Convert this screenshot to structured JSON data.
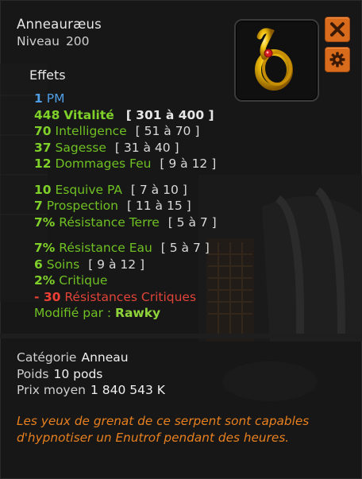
{
  "item": {
    "name": "Anneauræus",
    "level_label": "Niveau",
    "level": "200"
  },
  "buttons": {
    "close_icon": "close-icon",
    "gear_icon": "gear-icon"
  },
  "effects_title": "Effets",
  "effects": {
    "pm": {
      "value": "1",
      "name": "PM"
    },
    "vitalite": {
      "value": "448",
      "name": "Vitalité",
      "range": "[ 301 à 400 ]"
    },
    "intelligence": {
      "value": "70",
      "name": "Intelligence",
      "range": "[ 51 à 70 ]"
    },
    "sagesse": {
      "value": "37",
      "name": "Sagesse",
      "range": "[ 31 à 40 ]"
    },
    "dommages_feu": {
      "value": "12",
      "name": "Dommages Feu",
      "range": "[ 9 à 12 ]"
    },
    "esquive_pa": {
      "value": "10",
      "name": "Esquive PA",
      "range": "[ 7 à 10 ]"
    },
    "prospection": {
      "value": "7",
      "name": "Prospection",
      "range": "[ 11 à 15 ]"
    },
    "resistance_terre": {
      "value": "7%",
      "name": "Résistance Terre",
      "range": "[ 5 à 7 ]"
    },
    "resistance_eau": {
      "value": "7%",
      "name": "Résistance Eau",
      "range": "[ 5 à 7 ]"
    },
    "soins": {
      "value": "6",
      "name": "Soins",
      "range": "[ 9 à 12 ]"
    },
    "critique": {
      "value": "2%",
      "name": "Critique"
    },
    "resistances_critiques": {
      "value": "- 30",
      "name": "Résistances Critiques"
    },
    "modifie_par": {
      "label": "Modifié par :",
      "value": "Rawky"
    }
  },
  "info": {
    "categorie_label": "Catégorie",
    "categorie": "Anneau",
    "poids_label": "Poids",
    "poids": "10 pods",
    "prix_label": "Prix moyen",
    "prix": "1 840 543 K"
  },
  "description": "Les yeux de grenat de ce serpent sont capables d'hypnotiser un Enutrof pendant des heures.",
  "colors": {
    "panel_bg": "#171717",
    "accent_orange": "#d96b1d",
    "blue": "#4f9ee6",
    "green": "#7fd12a",
    "red": "#ee4035",
    "desc_orange": "#e8801f"
  }
}
